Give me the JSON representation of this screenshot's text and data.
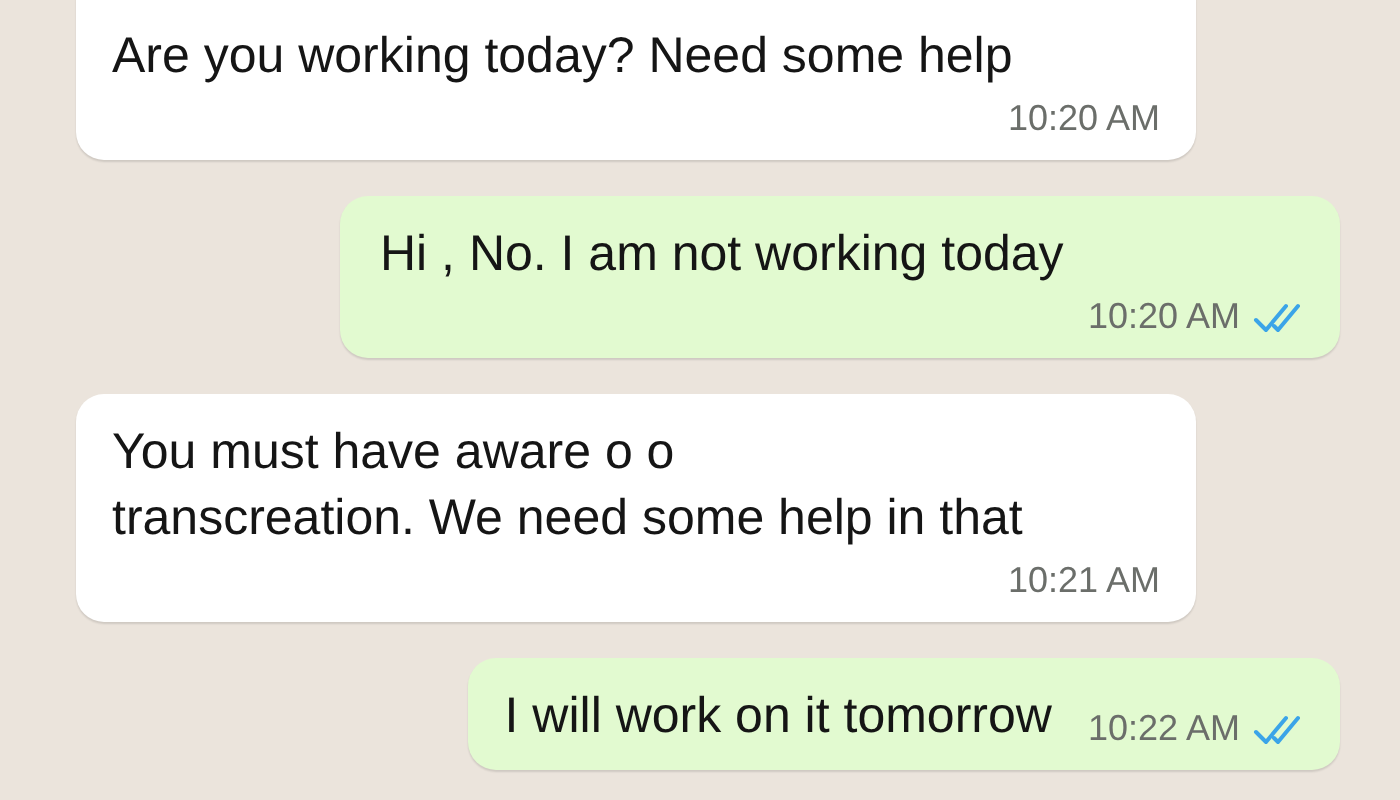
{
  "messages": [
    {
      "kind": "incoming",
      "text": "Are you working today? Need some help",
      "time": "10:20 AM"
    },
    {
      "kind": "outgoing",
      "text": "Hi , No. I am not working today",
      "time": "10:20 AM",
      "read": true
    },
    {
      "kind": "incoming",
      "text": "You must have aware o o\ntranscreation. We need some help in that",
      "time": "10:21 AM"
    },
    {
      "kind": "outgoing",
      "text": "I will work on it tomorrow",
      "time": "10:22 AM",
      "read": true
    }
  ]
}
